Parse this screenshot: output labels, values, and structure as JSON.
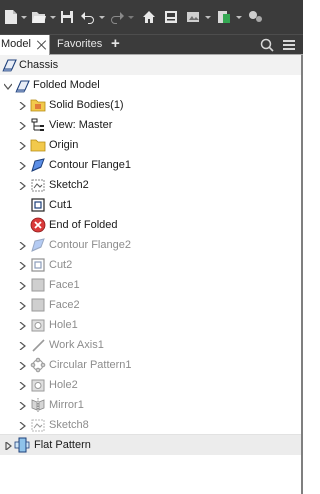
{
  "toolbar": {
    "buttons": [
      {
        "name": "new-file-icon",
        "interactable": true
      },
      {
        "name": "open-folder-icon",
        "interactable": true
      },
      {
        "name": "save-icon",
        "interactable": true
      },
      {
        "name": "undo-icon",
        "interactable": true
      },
      {
        "name": "redo-icon",
        "interactable": true
      },
      {
        "name": "home-icon",
        "interactable": true
      },
      {
        "name": "properties-icon",
        "interactable": true
      },
      {
        "name": "material-icon",
        "interactable": true
      },
      {
        "name": "appearance-icon",
        "interactable": true
      },
      {
        "name": "parameters-icon",
        "interactable": true
      }
    ]
  },
  "tabs": {
    "model_label": "Model",
    "favorites_label": "Favorites",
    "add_label": "+"
  },
  "tree": {
    "root": "Chassis",
    "items": [
      {
        "label": "Folded Model",
        "icon": "folded-model-icon",
        "dim": false
      },
      {
        "label": "Solid Bodies(1)",
        "icon": "solid-bodies-folder-icon",
        "dim": false
      },
      {
        "label": "View: Master",
        "icon": "view-icon",
        "dim": false
      },
      {
        "label": "Origin",
        "icon": "origin-folder-icon",
        "dim": false
      },
      {
        "label": "Contour Flange1",
        "icon": "contour-flange-icon",
        "dim": false
      },
      {
        "label": "Sketch2",
        "icon": "sketch-icon",
        "dim": false
      },
      {
        "label": "Cut1",
        "icon": "cut-icon",
        "dim": false
      },
      {
        "label": "End of Folded",
        "icon": "end-of-part-icon",
        "dim": false
      },
      {
        "label": "Contour Flange2",
        "icon": "contour-flange-icon",
        "dim": true
      },
      {
        "label": "Cut2",
        "icon": "cut-icon",
        "dim": true
      },
      {
        "label": "Face1",
        "icon": "face-icon",
        "dim": true
      },
      {
        "label": "Face2",
        "icon": "face-icon",
        "dim": true
      },
      {
        "label": "Hole1",
        "icon": "hole-icon",
        "dim": true
      },
      {
        "label": "Work Axis1",
        "icon": "work-axis-icon",
        "dim": true
      },
      {
        "label": "Circular Pattern1",
        "icon": "circular-pattern-icon",
        "dim": true
      },
      {
        "label": "Hole2",
        "icon": "hole-icon",
        "dim": true
      },
      {
        "label": "Mirror1",
        "icon": "mirror-icon",
        "dim": true
      },
      {
        "label": "Sketch8",
        "icon": "sketch-icon",
        "dim": true
      }
    ],
    "flat_pattern": "Flat Pattern"
  },
  "colors": {
    "toolbar_bg": "#3b3b3b",
    "error_red": "#d93a3a",
    "folder_yellow": "#f2c94c",
    "flange_blue": "#2b63c4"
  }
}
